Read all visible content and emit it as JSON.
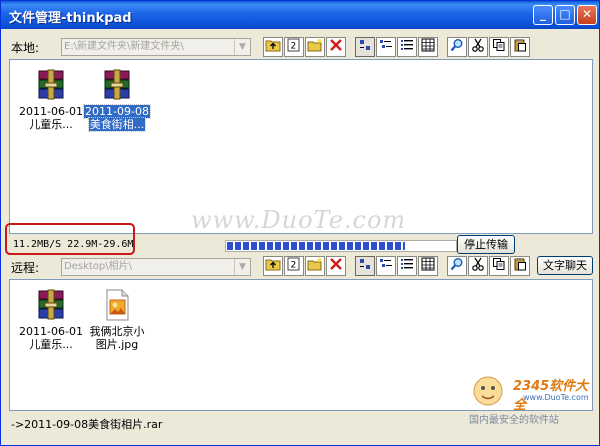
{
  "window": {
    "title": "文件管理-thinkpad",
    "controls": {
      "minimize": "_",
      "maximize": "□",
      "close": "✕"
    }
  },
  "local": {
    "label": "本地:",
    "path": "E:\\新建文件夹\\新建文件夹\\",
    "files": [
      {
        "date": "2011-06-01",
        "name": "儿童乐...",
        "icon": "winrar-archive-icon",
        "selected": false
      },
      {
        "date": "2011-09-08",
        "name": "美食街相...",
        "icon": "winrar-archive-icon",
        "selected": true
      }
    ]
  },
  "transfer": {
    "speed": "11.2MB/S  22.9M-29.6M",
    "progress": 0.78,
    "stop_label": "停止传输"
  },
  "remote": {
    "label": "远程:",
    "path": "Desktop\\相片\\",
    "chat_label": "文字聊天",
    "files": [
      {
        "date": "2011-06-01",
        "name": "儿童乐...",
        "icon": "winrar-archive-icon"
      },
      {
        "date": "我俩北京小",
        "name": "图片.jpg",
        "icon": "jpg-image-icon"
      }
    ]
  },
  "status": {
    "current_file": "->2011-09-08美食街相片.rar"
  },
  "toolbar_icons": [
    "folder-up-icon",
    "new-folder-icon",
    "open-folder-icon",
    "delete-icon",
    "small-icons-view-icon",
    "list-view-icon",
    "details-view-icon",
    "report-view-icon",
    "find-icon",
    "cut-icon",
    "copy-icon",
    "paste-icon"
  ],
  "watermarks": {
    "site": "www.DuoTe.com",
    "brand": "2345软件大全",
    "url": "www.DuoTe.com",
    "slogan": "国内最安全的软件站"
  },
  "colors": {
    "title_blue": "#1c64e8",
    "selection": "#316ac5",
    "progress": "#2c4fd6",
    "highlight_red": "#cc1818",
    "delete_red": "#d11a1a"
  }
}
